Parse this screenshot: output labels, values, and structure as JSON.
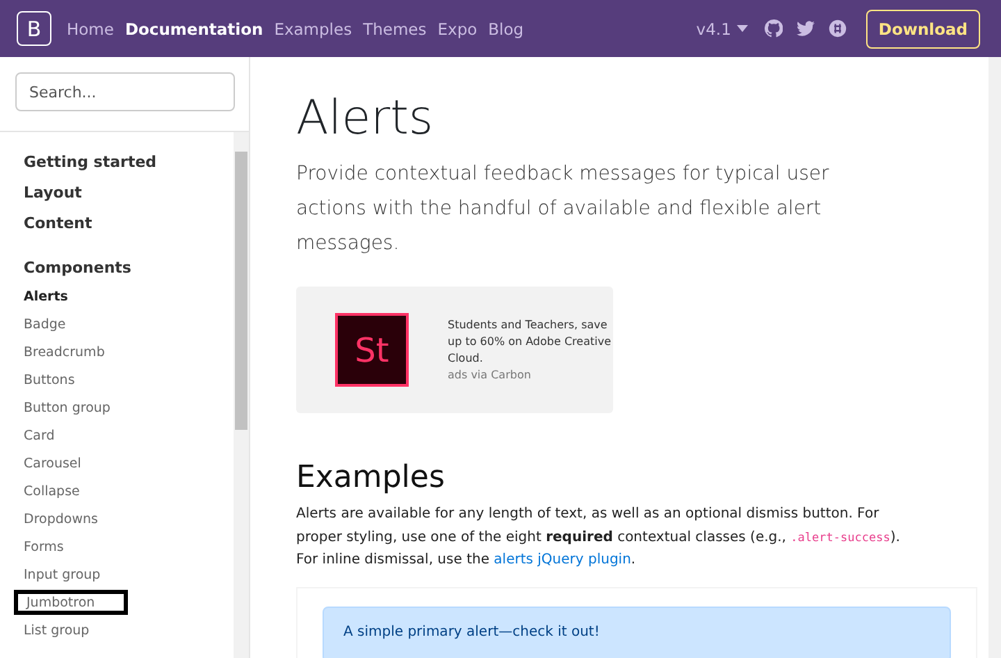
{
  "navbar": {
    "brand": "B",
    "links": [
      {
        "label": "Home",
        "selected": false
      },
      {
        "label": "Documentation",
        "selected": true
      },
      {
        "label": "Examples",
        "selected": false
      },
      {
        "label": "Themes",
        "selected": false
      },
      {
        "label": "Expo",
        "selected": false
      },
      {
        "label": "Blog",
        "selected": false
      }
    ],
    "version": "v4.1",
    "download": "Download"
  },
  "sidebar": {
    "search": {
      "placeholder": "Search..."
    },
    "sections": [
      {
        "title": "Getting started"
      },
      {
        "title": "Layout"
      },
      {
        "title": "Content"
      },
      {
        "title": "Components",
        "items": [
          {
            "label": "Alerts",
            "selected": true,
            "highlighted": false
          },
          {
            "label": "Badge",
            "selected": false,
            "highlighted": false
          },
          {
            "label": "Breadcrumb",
            "selected": false,
            "highlighted": false
          },
          {
            "label": "Buttons",
            "selected": false,
            "highlighted": false
          },
          {
            "label": "Button group",
            "selected": false,
            "highlighted": false
          },
          {
            "label": "Card",
            "selected": false,
            "highlighted": false
          },
          {
            "label": "Carousel",
            "selected": false,
            "highlighted": false
          },
          {
            "label": "Collapse",
            "selected": false,
            "highlighted": false
          },
          {
            "label": "Dropdowns",
            "selected": false,
            "highlighted": false
          },
          {
            "label": "Forms",
            "selected": false,
            "highlighted": false
          },
          {
            "label": "Input group",
            "selected": false,
            "highlighted": false
          },
          {
            "label": "Jumbotron",
            "selected": false,
            "highlighted": true
          },
          {
            "label": "List group",
            "selected": false,
            "highlighted": false
          }
        ]
      }
    ]
  },
  "main": {
    "title": "Alerts",
    "lead": "Provide contextual feedback messages for typical user actions with the handful of available and flexible alert messages.",
    "ad": {
      "logo": "St",
      "text": "Students and Teachers, save up to 60% on Adobe Creative Cloud.",
      "credit": "ads via Carbon"
    },
    "examples_title": "Examples",
    "paragraph": [
      {
        "kind": "text",
        "text": "Alerts are available for any length of text, as well as an optional dismiss button. For proper styling, use one of the eight "
      },
      {
        "kind": "bold",
        "text": "required"
      },
      {
        "kind": "text",
        "text": " contextual classes (e.g., "
      },
      {
        "kind": "code",
        "text": ".alert-success"
      },
      {
        "kind": "text",
        "text": "). For inline dismissal, use the "
      },
      {
        "kind": "link",
        "text": "alerts jQuery plugin"
      },
      {
        "kind": "text",
        "text": "."
      }
    ],
    "alerts": [
      "A simple primary alert—check it out!"
    ]
  }
}
